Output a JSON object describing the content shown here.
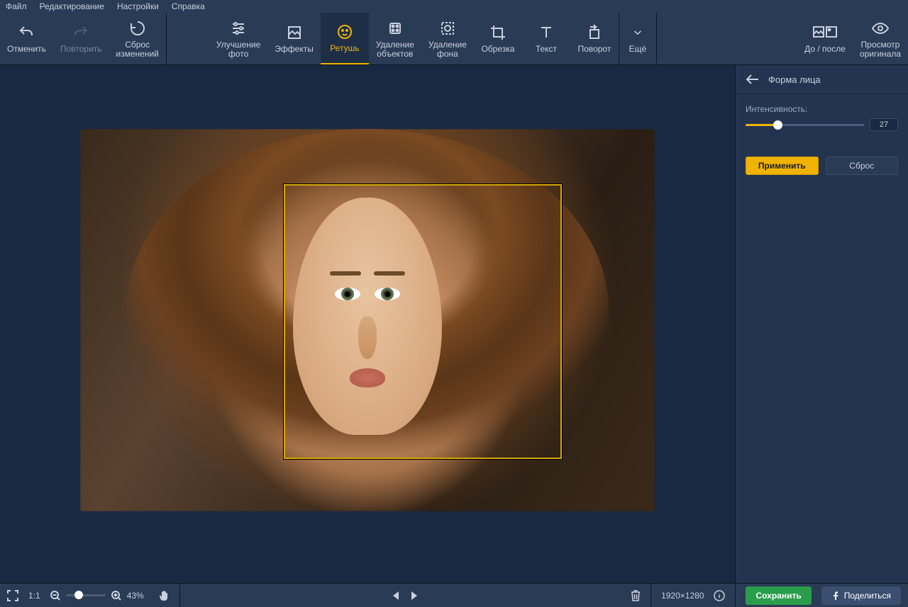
{
  "menubar": {
    "file": "Файл",
    "edit": "Редактирование",
    "settings": "Настройки",
    "help": "Справка"
  },
  "toolbar": {
    "undo": "Отменить",
    "redo": "Повторить",
    "reset": "Сброс\nизменений",
    "enhance": "Улучшение\nфото",
    "effects": "Эффекты",
    "retouch": "Ретушь",
    "remove_obj": "Удаление\nобъектов",
    "remove_bg": "Удаление\nфона",
    "crop": "Обрезка",
    "text": "Текст",
    "rotate": "Поворот",
    "more": "Ещё",
    "before_after": "До / после",
    "view_original": "Просмотр\nоригинала"
  },
  "panel": {
    "title": "Форма лица",
    "intensity_label": "Интенсивность:",
    "intensity_value": "27",
    "intensity_percent": 27,
    "apply": "Применить",
    "reset": "Сброс"
  },
  "status": {
    "scale_11": "1:1",
    "zoom_percent": "43%",
    "dimensions": "1920×1280",
    "save": "Сохранить",
    "share": "Поделиться"
  }
}
